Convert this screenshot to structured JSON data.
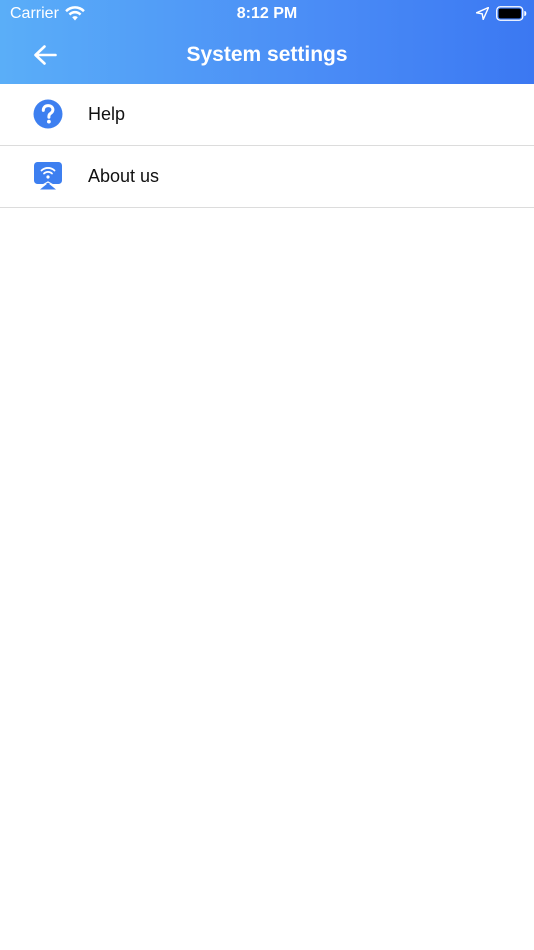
{
  "status_bar": {
    "carrier": "Carrier",
    "time": "8:12 PM",
    "icons": [
      "wifi-icon",
      "location-icon",
      "battery-icon"
    ]
  },
  "nav": {
    "back_icon": "arrow-left-icon",
    "title": "System settings"
  },
  "menu": {
    "items": [
      {
        "label": "Help",
        "icon": "help-circle-icon"
      },
      {
        "label": "About us",
        "icon": "screen-cast-icon"
      }
    ]
  },
  "colors": {
    "header_start": "#5aaef8",
    "header_end": "#3b78f2",
    "accent": "#3d7ff0",
    "divider": "#dcdcdc",
    "background": "#ffffff"
  }
}
